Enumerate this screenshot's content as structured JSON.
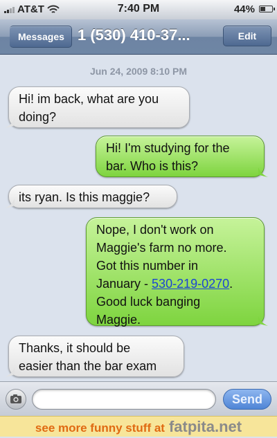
{
  "status_bar": {
    "carrier": "AT&T",
    "time": "7:40 PM",
    "battery_text": "44%",
    "battery_level": 0.44,
    "icons": [
      "signal-icon",
      "wifi-icon",
      "battery-icon"
    ]
  },
  "nav": {
    "back_label": "Messages",
    "title": "1 (530) 410-37...",
    "edit_label": "Edit"
  },
  "conversation": {
    "timestamp": "Jun 24, 2009 8:10 PM",
    "messages": [
      {
        "direction": "incoming",
        "lines": [
          "Hi! im back, what are you",
          "doing?"
        ]
      },
      {
        "direction": "outgoing",
        "lines": [
          "Hi! I'm studying for the",
          "bar. Who is this?"
        ]
      },
      {
        "direction": "incoming",
        "lines": [
          "its ryan. Is this maggie?"
        ]
      },
      {
        "direction": "outgoing",
        "lines": [
          "Nope, I don't work on",
          "Maggie's farm no more.",
          "Got this number in",
          "January - ",
          "Good luck banging",
          "Maggie."
        ],
        "link": "530-219-0270",
        "link_suffix": "."
      },
      {
        "direction": "incoming",
        "lines": [
          "Thanks, it should be",
          "easier than the bar exam"
        ]
      }
    ]
  },
  "input_bar": {
    "send_label": "Send",
    "text_value": ""
  },
  "footer": {
    "promo": "see more funny stuff at",
    "brand": "fatpita.net"
  },
  "colors": {
    "incoming_bubble": "#e8e8e8",
    "outgoing_bubble": "#8edb4e",
    "link": "#1a44d4",
    "promo": "#e06a12"
  }
}
